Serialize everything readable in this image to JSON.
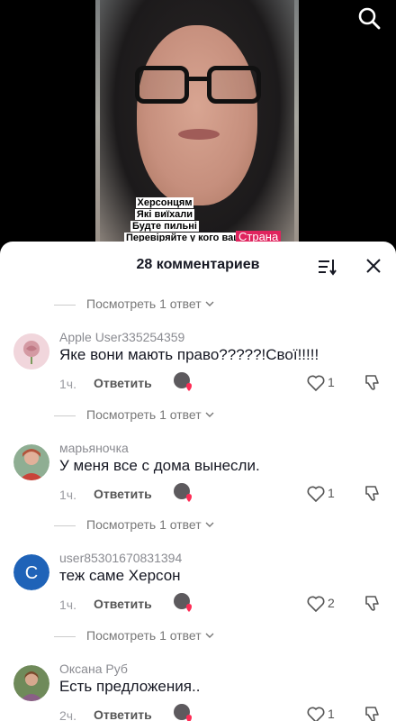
{
  "video": {
    "caption_lines": [
      "Херсонцям",
      "Які виїхали",
      "Будте пильні",
      "Перевіряйте у кого ваши"
    ],
    "brand_text": "Страна",
    "search_icon": "search-icon"
  },
  "sheet": {
    "title": "28 комментариев",
    "sort_icon": "sort-icon",
    "close_icon": "close-icon",
    "view_replies_label": "Посмотреть 1 ответ"
  },
  "comments": [
    {
      "username": "Apple User335254359",
      "text": "Яке вони мають право?????!Свої!!!!!",
      "time": "1ч.",
      "reply_label": "Ответить",
      "likes": "1",
      "avatar": {
        "icon": "rose-avatar",
        "color": "#d49aa3"
      }
    },
    {
      "username": "марьяночка",
      "text": "У меня все с дома вынесли.",
      "time": "1ч.",
      "reply_label": "Ответить",
      "likes": "1",
      "avatar": {
        "icon": "photo-avatar",
        "color": "#b3543c"
      }
    },
    {
      "username": "user85301670831394",
      "text": "теж саме Херсон",
      "time": "1ч.",
      "reply_label": "Ответить",
      "likes": "2",
      "avatar": {
        "icon": "letter-avatar",
        "letter": "C",
        "color": "#1f63b8"
      }
    },
    {
      "username": "Оксана Руб",
      "text": "Есть предложения..",
      "time": "2ч.",
      "reply_label": "Ответить",
      "likes": "1",
      "avatar": {
        "icon": "photo-avatar",
        "color": "#6f8a5a"
      }
    }
  ]
}
